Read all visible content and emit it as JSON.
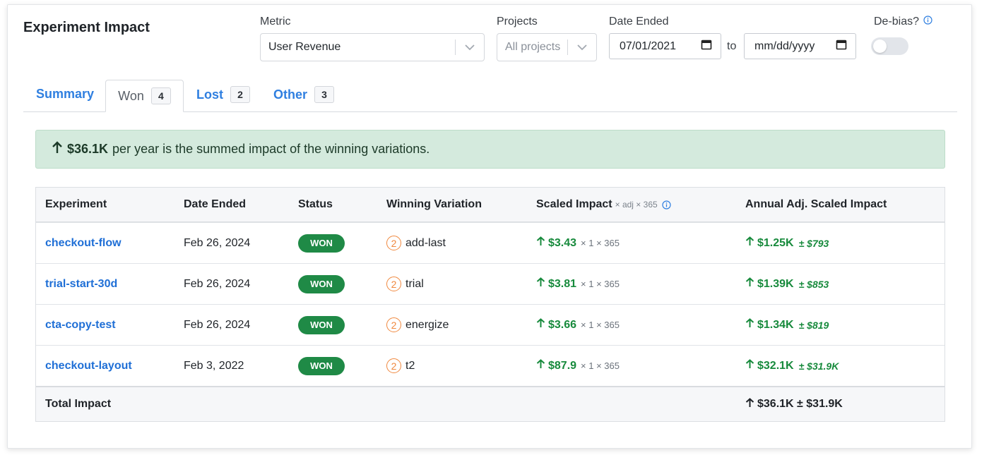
{
  "header": {
    "title": "Experiment Impact"
  },
  "filters": {
    "metric_label": "Metric",
    "metric_value": "User Revenue",
    "projects_label": "Projects",
    "projects_placeholder": "All projects",
    "date_label": "Date Ended",
    "date_from": "07/01/2021",
    "date_to_sep": "to",
    "date_to": "mm/dd/yyyy",
    "debias_label": "De-bias?",
    "debias_on": false
  },
  "tabs": [
    {
      "label": "Summary",
      "count": ""
    },
    {
      "label": "Won",
      "count": "4"
    },
    {
      "label": "Lost",
      "count": "2"
    },
    {
      "label": "Other",
      "count": "3"
    }
  ],
  "banner": {
    "amount": "$36.1K",
    "text": "per year is the summed impact of the winning variations."
  },
  "table": {
    "headers": {
      "experiment": "Experiment",
      "date": "Date Ended",
      "status": "Status",
      "variation": "Winning Variation",
      "scaled": "Scaled Impact",
      "scaled_note": "× adj × 365",
      "annual": "Annual Adj. Scaled Impact"
    },
    "rows": [
      {
        "experiment": "checkout-flow",
        "date": "Feb 26, 2024",
        "status": "WON",
        "var_num": "2",
        "variation": "add-last",
        "scaled": "$3.43",
        "mult": "× 1 × 365",
        "annual": "$1.25K",
        "ci": "± $793"
      },
      {
        "experiment": "trial-start-30d",
        "date": "Feb 26, 2024",
        "status": "WON",
        "var_num": "2",
        "variation": "trial",
        "scaled": "$3.81",
        "mult": "× 1 × 365",
        "annual": "$1.39K",
        "ci": "± $853"
      },
      {
        "experiment": "cta-copy-test",
        "date": "Feb 26, 2024",
        "status": "WON",
        "var_num": "2",
        "variation": "energize",
        "scaled": "$3.66",
        "mult": "× 1 × 365",
        "annual": "$1.34K",
        "ci": "± $819"
      },
      {
        "experiment": "checkout-layout",
        "date": "Feb 3, 2022",
        "status": "WON",
        "var_num": "2",
        "variation": "t2",
        "scaled": "$87.9",
        "mult": "× 1 × 365",
        "annual": "$32.1K",
        "ci": "± $31.9K"
      }
    ],
    "footer": {
      "label": "Total Impact",
      "total": "$36.1K ± $31.9K"
    }
  },
  "colors": {
    "accent": "#2f7fe0",
    "won": "#1f8a46",
    "positive": "#178a3c",
    "variation": "#f0883e",
    "banner_bg": "#d4eadd"
  },
  "icons": [
    "chevron-down-icon",
    "calendar-icon",
    "info-icon",
    "arrow-up-icon"
  ]
}
